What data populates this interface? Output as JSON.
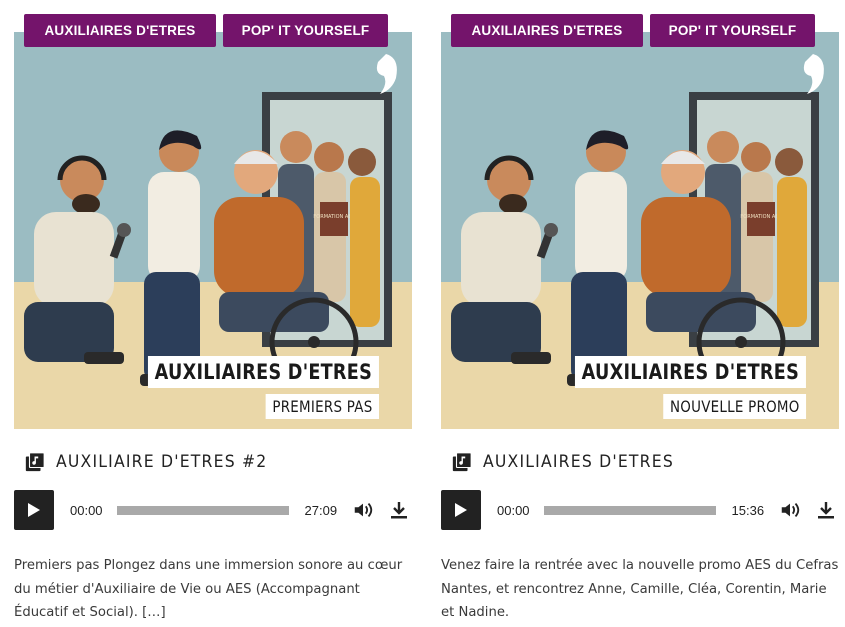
{
  "cards": [
    {
      "tags": [
        "AUXILIAIRES D'ETRES",
        "POP' IT YOURSELF"
      ],
      "artwork": {
        "caption_main": "AUXILIAIRES D'ETRES",
        "caption_sub": "PREMIERS PAS",
        "book_label": "FORMATION AES"
      },
      "title": "AUXILIAIRE D'ETRES #2",
      "player": {
        "current": "00:00",
        "duration": "27:09",
        "progress": 0
      },
      "description": "Premiers pas Plongez dans une immersion sonore au cœur du métier d'Auxiliaire de Vie ou AES (Accompagnant Éducatif et Social). […]"
    },
    {
      "tags": [
        "AUXILIAIRES D'ETRES",
        "POP' IT YOURSELF"
      ],
      "artwork": {
        "caption_main": "AUXILIAIRES D'ETRES",
        "caption_sub": "NOUVELLE PROMO",
        "book_label": "FORMATION AES"
      },
      "title": "AUXILIAIRES D'ETRES",
      "player": {
        "current": "00:00",
        "duration": "15:36",
        "progress": 0
      },
      "description": "Venez faire la rentrée avec la nouvelle promo AES du Cefras Nantes, et rencontrez Anne, Camille, Cléa, Corentin, Marie et Nadine."
    }
  ],
  "icons": {
    "tag_bg": "#74146b",
    "title_icon": "music-library-icon",
    "play_icon": "play-icon",
    "volume_icon": "volume-icon",
    "download_icon": "download-icon"
  }
}
